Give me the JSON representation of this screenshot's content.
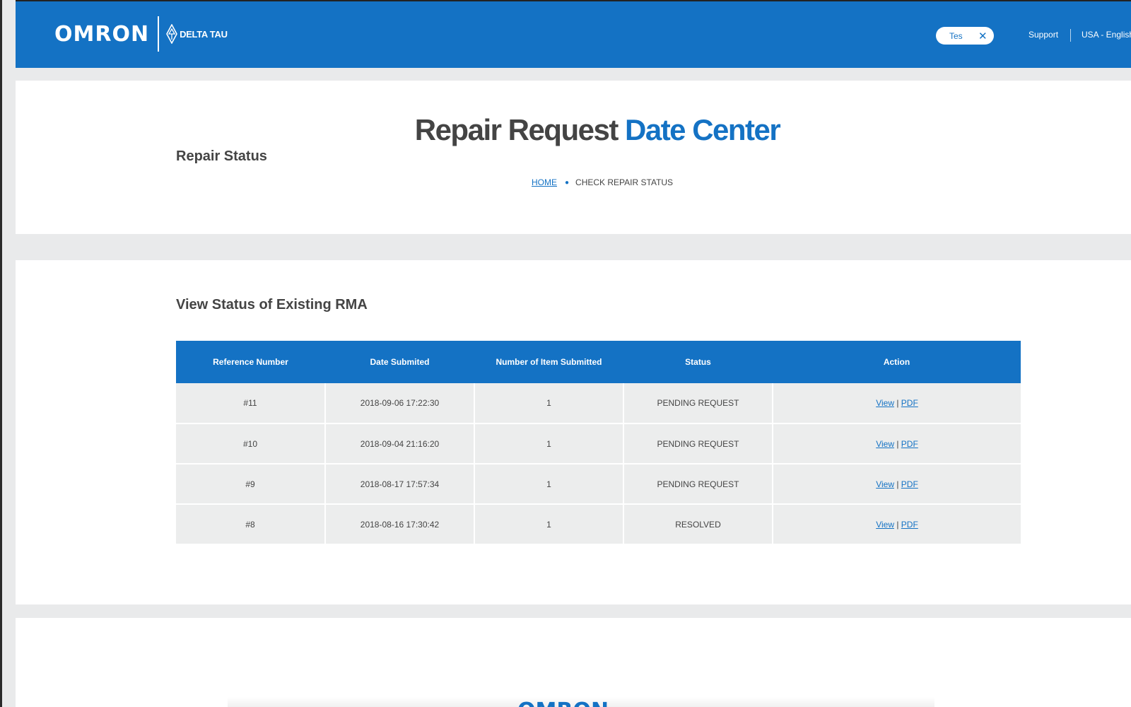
{
  "header": {
    "logo_text": "OMRON",
    "sub_logo_text": "DELTA TAU",
    "search_value": "Tes",
    "nav_support": "Support",
    "nav_language": "USA - English"
  },
  "hero": {
    "title_main": "Repair Request",
    "title_accent": "Date Center",
    "subtitle": "Repair Status",
    "breadcrumb": {
      "home": "HOME",
      "current": "CHECK REPAIR STATUS"
    }
  },
  "rma": {
    "title": "View Status of Existing RMA",
    "columns": [
      "Reference Number",
      "Date Submited",
      "Number of Item Submitted",
      "Status",
      "Action"
    ],
    "rows": [
      {
        "ref": "#11",
        "date": "2018-09-06 17:22:30",
        "items": "1",
        "status": "PENDING REQUEST"
      },
      {
        "ref": "#10",
        "date": "2018-09-04 21:16:20",
        "items": "1",
        "status": "PENDING REQUEST"
      },
      {
        "ref": "#9",
        "date": "2018-08-17 17:57:34",
        "items": "1",
        "status": "PENDING REQUEST"
      },
      {
        "ref": "#8",
        "date": "2018-08-16 17:30:42",
        "items": "1",
        "status": "RESOLVED"
      }
    ],
    "action_view": "View",
    "action_sep": "|",
    "action_pdf": "PDF"
  },
  "colors": {
    "brand": "#1472c4",
    "cell_bg": "#eceded",
    "page_bg": "#e9eaeb"
  },
  "icons": {
    "search_clear": "close-icon",
    "language": "flag-icon",
    "brand": "delta-tau-diamond-icon"
  }
}
